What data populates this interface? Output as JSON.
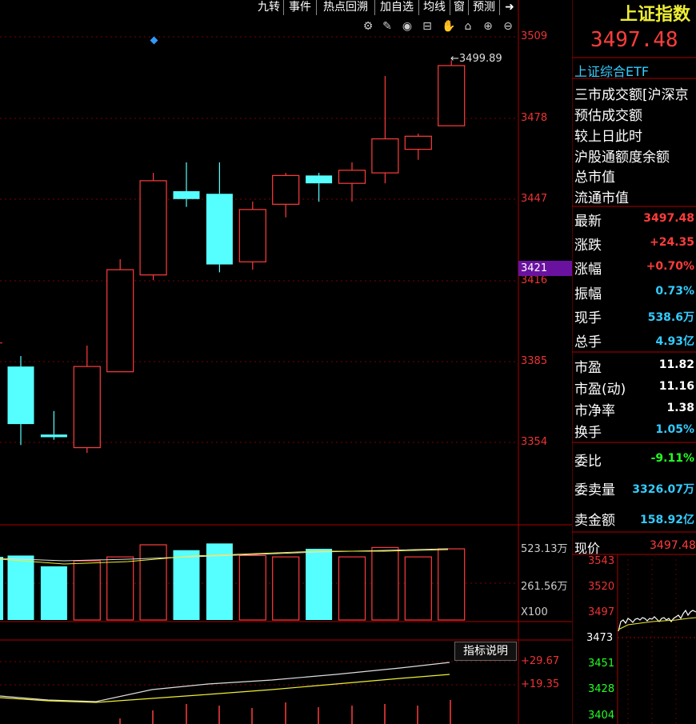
{
  "toolbar": {
    "tabs": [
      "九转",
      "事件",
      "热点回溯",
      "加自选",
      "均线",
      "窗",
      "预测"
    ],
    "arrow_icon": "export-arrow-icon",
    "tools": [
      "gear-icon",
      "pen-icon",
      "eye-icon",
      "lock-icon",
      "hand-icon",
      "home-icon",
      "zoom-in-icon",
      "zoom-out-icon"
    ]
  },
  "price_axis": {
    "labels": [
      "3509",
      "3478",
      "3447",
      "3416",
      "3385",
      "3354"
    ],
    "current_marker": "3421"
  },
  "high_annotation": "3499.89",
  "volume_axis": {
    "labels": [
      "523.13万",
      "261.56万"
    ],
    "unit": "X100"
  },
  "indicator": {
    "button": "指标说明",
    "labels": [
      "+29.67",
      "+19.35"
    ]
  },
  "chart_data": {
    "type": "candlestick",
    "ylim": [
      3340,
      3518
    ],
    "candles": [
      {
        "open": 3383,
        "close": 3361,
        "high": 3387,
        "low": 3353,
        "color": "down"
      },
      {
        "open": 3357,
        "close": 3356,
        "high": 3366,
        "low": 3355,
        "color": "down"
      },
      {
        "open": 3352,
        "close": 3383,
        "high": 3391,
        "low": 3350,
        "color": "up"
      },
      {
        "open": 3381,
        "close": 3420,
        "high": 3424,
        "low": 3381,
        "color": "up"
      },
      {
        "open": 3418,
        "close": 3454,
        "high": 3457,
        "low": 3416,
        "color": "up"
      },
      {
        "open": 3450,
        "close": 3447,
        "high": 3461,
        "low": 3444,
        "color": "down"
      },
      {
        "open": 3449,
        "close": 3422,
        "high": 3461,
        "low": 3419,
        "color": "down"
      },
      {
        "open": 3423,
        "close": 3443,
        "high": 3446,
        "low": 3420,
        "color": "up"
      },
      {
        "open": 3445,
        "close": 3456,
        "high": 3457,
        "low": 3440,
        "color": "up"
      },
      {
        "open": 3456,
        "close": 3453,
        "high": 3457,
        "low": 3446,
        "color": "down"
      },
      {
        "open": 3453,
        "close": 3458,
        "high": 3461,
        "low": 3446,
        "color": "up"
      },
      {
        "open": 3457,
        "close": 3470,
        "high": 3494,
        "low": 3453,
        "color": "up"
      },
      {
        "open": 3466,
        "close": 3471,
        "high": 3472,
        "low": 3462,
        "color": "up"
      },
      {
        "open": 3475,
        "close": 3498,
        "high": 3500,
        "low": 3475,
        "color": "up"
      }
    ],
    "volumes": [
      480,
      400,
      440,
      470,
      560,
      520,
      570,
      480,
      470,
      530,
      470,
      540,
      470,
      530
    ],
    "colors": {
      "up": "#ff3c3c",
      "down": "#5ff",
      "ma_white": "#ddd",
      "ma_yellow": "#ee3"
    }
  },
  "panel": {
    "title": "上证指数",
    "price": "3497.48",
    "etf": "上证综合ETF",
    "info_rows": [
      "三市成交额[沪深京",
      "预估成交额",
      "较上日此时",
      "沪股通额度余额",
      "总市值",
      "流通市值"
    ],
    "stats": [
      {
        "label": "最新",
        "value": "3497.48",
        "color": "red"
      },
      {
        "label": "涨跌",
        "value": "+24.35",
        "color": "red"
      },
      {
        "label": "涨幅",
        "value": "+0.70%",
        "color": "red"
      },
      {
        "label": "振幅",
        "value": "0.73%",
        "color": "cyan"
      },
      {
        "label": "现手",
        "value": "538.6万",
        "color": "cyan"
      },
      {
        "label": "总手",
        "value": "4.93亿",
        "color": "cyan"
      },
      {
        "label": "市盈",
        "value": "11.82",
        "color": "white"
      },
      {
        "label": "市盈(动)",
        "value": "11.16",
        "color": "white"
      },
      {
        "label": "市净率",
        "value": "1.38",
        "color": "white"
      },
      {
        "label": "换手",
        "value": "1.05%",
        "color": "cyan"
      },
      {
        "label": "委比",
        "value": "-9.11%",
        "color": "green"
      },
      {
        "label": "委卖量",
        "value": "3326.07万",
        "color": "cyan"
      },
      {
        "label": "卖金额",
        "value": "158.92亿",
        "color": "cyan"
      }
    ],
    "current_label": "现价",
    "current_value": "3497.48",
    "mini_axis": [
      "3543",
      "3520",
      "3497",
      "3473",
      "3451",
      "3428",
      "3404"
    ]
  }
}
